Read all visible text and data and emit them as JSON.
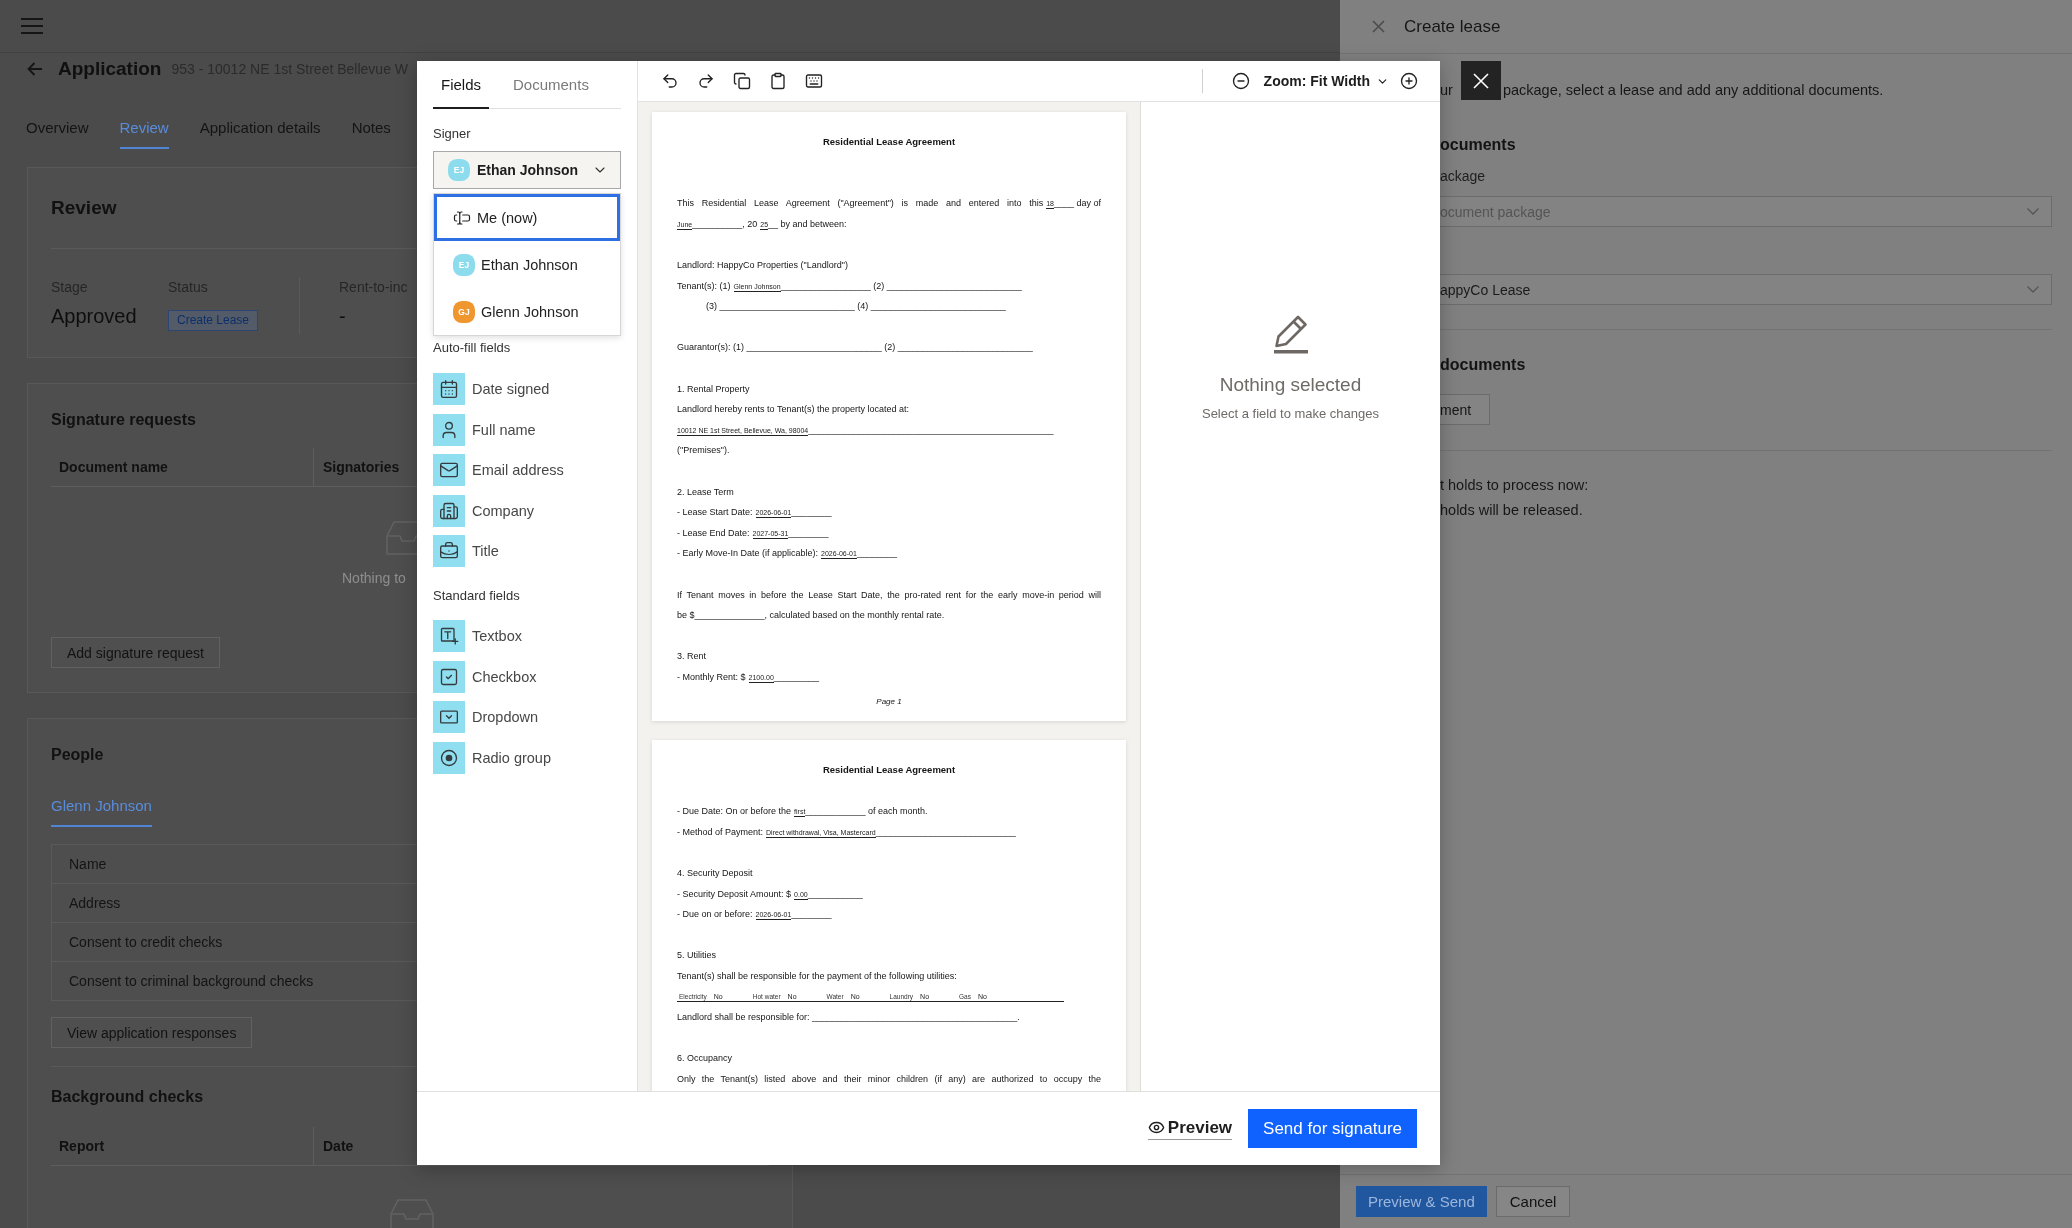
{
  "app": {
    "header": {
      "title": "Application",
      "address": "953 - 10012 NE 1st Street Bellevue W"
    },
    "tabs": [
      {
        "label": "Overview",
        "selected": false
      },
      {
        "label": "Review",
        "selected": true
      },
      {
        "label": "Application details",
        "selected": false
      },
      {
        "label": "Notes",
        "selected": false
      }
    ],
    "review": {
      "title": "Review",
      "stat_groups": [
        [
          {
            "kind": "text",
            "label": "Stage",
            "value": "Approved"
          },
          {
            "kind": "badge",
            "label": "Status",
            "value": "Create Lease"
          }
        ],
        [
          {
            "kind": "text",
            "label": "Rent-to-inc",
            "value": "-"
          }
        ]
      ]
    },
    "signature_requests": {
      "title": "Signature requests",
      "columns": [
        "Document name",
        "Signatories"
      ],
      "empty_text": "Nothing to",
      "button": "Add signature request"
    },
    "people": {
      "title": "People",
      "tabs": [
        {
          "label": "Glenn Johnson",
          "selected": true
        }
      ],
      "rows": [
        "Name",
        "Address",
        "Consent to credit checks",
        "Consent to criminal background checks"
      ],
      "button": "View application responses"
    },
    "background_checks": {
      "title": "Background checks",
      "columns": [
        "Report",
        "Date"
      ]
    }
  },
  "drawer": {
    "title": "Create lease",
    "intro": [
      "ur",
      "package, select a lease and add any additional documents."
    ],
    "package_section": {
      "heading": "ocuments",
      "label": "ackage",
      "selects": [
        {
          "placeholder": "ocument package"
        },
        {
          "value": "appyCo Lease"
        }
      ]
    },
    "documents_section": {
      "heading": "documents",
      "button": "ment"
    },
    "notice": [
      "t holds to process now:",
      "holds will be released."
    ],
    "buttons": [
      {
        "kind": "primary",
        "label": "Preview & Send"
      },
      {
        "kind": "secondary",
        "label": "Cancel"
      }
    ]
  },
  "modal": {
    "tabs": [
      {
        "label": "Fields",
        "selected": true
      },
      {
        "label": "Documents",
        "selected": false
      }
    ],
    "signer": {
      "label": "Signer",
      "current": {
        "initials": "EJ",
        "name": "Ethan Johnson",
        "color": "#8ddcee"
      },
      "expanded": true,
      "options": [
        {
          "kind": "self",
          "label": "Me (now)",
          "selected": true
        },
        {
          "kind": "person",
          "initials": "EJ",
          "label": "Ethan Johnson",
          "color": "#8ddcee",
          "selected": false
        },
        {
          "kind": "person",
          "initials": "GJ",
          "label": "Glenn Johnson",
          "color": "#f0962e",
          "selected": false
        }
      ]
    },
    "field_groups": [
      {
        "title": "Auto-fill fields",
        "items": [
          {
            "kind": "date",
            "label": "Date signed"
          },
          {
            "kind": "person",
            "label": "Full name"
          },
          {
            "kind": "email",
            "label": "Email address"
          },
          {
            "kind": "company",
            "label": "Company"
          },
          {
            "kind": "title",
            "label": "Title"
          }
        ]
      },
      {
        "title": "Standard fields",
        "items": [
          {
            "kind": "textbox",
            "label": "Textbox"
          },
          {
            "kind": "checkbox",
            "label": "Checkbox"
          },
          {
            "kind": "dropdown",
            "label": "Dropdown"
          },
          {
            "kind": "radio",
            "label": "Radio group"
          }
        ]
      }
    ],
    "toolbar": {
      "zoom": "Zoom: Fit Width"
    },
    "pages": [
      {
        "title": "Residential Lease Agreement",
        "continues": false,
        "paragraphs": [
          {
            "lines": [
              {
                "kind": "justified",
                "parts": [
                  {
                    "kind": "text",
                    "text": "This Residential Lease Agreement (\"Agreement\") is made and entered into this"
                  },
                  {
                    "kind": "fill",
                    "text": "18"
                  },
                  {
                    "kind": "text",
                    "text": "____ day of"
                  }
                ]
              },
              {
                "kind": "plain",
                "parts": [
                  {
                    "kind": "fill",
                    "text": "June"
                  },
                  {
                    "kind": "text",
                    "text": "__________, 20"
                  },
                  {
                    "kind": "fill",
                    "text": "25"
                  },
                  {
                    "kind": "text",
                    "text": "__ by and between:"
                  }
                ]
              }
            ]
          },
          {
            "lines": [
              {
                "kind": "plain",
                "parts": [
                  {
                    "kind": "text",
                    "text": "Landlord: HappyCo Properties (\"Landlord\")"
                  }
                ]
              },
              {
                "kind": "plain",
                "parts": [
                  {
                    "kind": "text",
                    "text": "Tenant(s): (1)"
                  },
                  {
                    "kind": "fill",
                    "text": "Glenn Johnson"
                  },
                  {
                    "kind": "text",
                    "text": "__________________ (2) ___________________________"
                  }
                ]
              },
              {
                "kind": "indented",
                "parts": [
                  {
                    "kind": "text",
                    "text": "(3) ___________________________ (4) ___________________________"
                  }
                ]
              }
            ]
          },
          {
            "lines": [
              {
                "kind": "plain",
                "parts": [
                  {
                    "kind": "text",
                    "text": "Guarantor(s): (1) ___________________________ (2) ___________________________"
                  }
                ]
              }
            ]
          },
          {
            "lines": [
              {
                "kind": "plain",
                "parts": [
                  {
                    "kind": "text",
                    "text": "1. Rental Property"
                  }
                ]
              },
              {
                "kind": "plain",
                "parts": [
                  {
                    "kind": "text",
                    "text": "Landlord hereby rents to Tenant(s) the property located at:"
                  }
                ]
              },
              {
                "kind": "plain",
                "parts": [
                  {
                    "kind": "fill",
                    "text": "10012 NE 1st Street, Bellevue, Wa, 98004"
                  },
                  {
                    "kind": "text",
                    "text": "_________________________________________________"
                  }
                ]
              },
              {
                "kind": "plain",
                "parts": [
                  {
                    "kind": "text",
                    "text": "(\"Premises\")."
                  }
                ]
              }
            ]
          },
          {
            "lines": [
              {
                "kind": "plain",
                "parts": [
                  {
                    "kind": "text",
                    "text": "2. Lease Term"
                  }
                ]
              },
              {
                "kind": "plain",
                "parts": [
                  {
                    "kind": "text",
                    "text": "- Lease Start Date:"
                  },
                  {
                    "kind": "fill",
                    "text": "2026-06-01"
                  },
                  {
                    "kind": "text",
                    "text": "________"
                  }
                ]
              },
              {
                "kind": "plain",
                "parts": [
                  {
                    "kind": "text",
                    "text": "- Lease End Date:"
                  },
                  {
                    "kind": "fill",
                    "text": "2027-05-31"
                  },
                  {
                    "kind": "text",
                    "text": "________"
                  }
                ]
              },
              {
                "kind": "plain",
                "parts": [
                  {
                    "kind": "text",
                    "text": "- Early Move-In Date (if applicable):"
                  },
                  {
                    "kind": "fill",
                    "text": "2026-06-01"
                  },
                  {
                    "kind": "text",
                    "text": "________"
                  }
                ]
              }
            ]
          },
          {
            "lines": [
              {
                "kind": "justified",
                "parts": [
                  {
                    "kind": "text",
                    "text": "If Tenant moves in before the Lease Start Date, the pro-rated rent for the early move-in period will"
                  }
                ]
              },
              {
                "kind": "plain",
                "parts": [
                  {
                    "kind": "text",
                    "text": "be $______________, calculated based on the monthly rental rate."
                  }
                ]
              }
            ]
          },
          {
            "lines": [
              {
                "kind": "plain",
                "parts": [
                  {
                    "kind": "text",
                    "text": "3. Rent"
                  }
                ]
              },
              {
                "kind": "plain",
                "parts": [
                  {
                    "kind": "text",
                    "text": "- Monthly Rent: $"
                  },
                  {
                    "kind": "fill",
                    "text": "2100.00"
                  },
                  {
                    "kind": "text",
                    "text": "_________"
                  }
                ]
              }
            ]
          }
        ],
        "footer": "Page 1"
      },
      {
        "title": "Residential Lease Agreement",
        "continues": true,
        "paragraphs": [
          {
            "lines": [
              {
                "kind": "plain",
                "parts": [
                  {
                    "kind": "text",
                    "text": "- Due Date: On or before the"
                  },
                  {
                    "kind": "fill",
                    "text": "first"
                  },
                  {
                    "kind": "text",
                    "text": "____________ of each month."
                  }
                ]
              },
              {
                "kind": "plain",
                "parts": [
                  {
                    "kind": "text",
                    "text": "- Method of Payment:"
                  },
                  {
                    "kind": "fill",
                    "text": "Direct withdrawal, Visa, Mastercard"
                  },
                  {
                    "kind": "text",
                    "text": "____________________________"
                  }
                ]
              }
            ]
          },
          {
            "lines": [
              {
                "kind": "plain",
                "parts": [
                  {
                    "kind": "text",
                    "text": "4. Security Deposit"
                  }
                ]
              },
              {
                "kind": "plain",
                "parts": [
                  {
                    "kind": "text",
                    "text": "- Security Deposit Amount: $"
                  },
                  {
                    "kind": "fill",
                    "text": "0.00"
                  },
                  {
                    "kind": "text",
                    "text": "___________"
                  }
                ]
              },
              {
                "kind": "plain",
                "parts": [
                  {
                    "kind": "text",
                    "text": "- Due on or before:"
                  },
                  {
                    "kind": "fill",
                    "text": "2026-06-01"
                  },
                  {
                    "kind": "text",
                    "text": "________"
                  }
                ]
              }
            ]
          },
          {
            "lines": [
              {
                "kind": "plain",
                "parts": [
                  {
                    "kind": "text",
                    "text": "5. Utilities"
                  }
                ]
              },
              {
                "kind": "plain",
                "parts": [
                  {
                    "kind": "text",
                    "text": "Tenant(s) shall be responsible for the payment of the following utilities:"
                  }
                ]
              },
              {
                "kind": "ruled",
                "parts": [
                  {
                    "kind": "label",
                    "text": "Electricity"
                  },
                  {
                    "kind": "fill",
                    "text": "No"
                  },
                  {
                    "kind": "label",
                    "text": "Hot water"
                  },
                  {
                    "kind": "fill",
                    "text": "No"
                  },
                  {
                    "kind": "label",
                    "text": "Water"
                  },
                  {
                    "kind": "fill",
                    "text": "No"
                  },
                  {
                    "kind": "label",
                    "text": "Laundry"
                  },
                  {
                    "kind": "fill",
                    "text": "No"
                  },
                  {
                    "kind": "label",
                    "text": "Gas"
                  },
                  {
                    "kind": "fill",
                    "text": "No"
                  }
                ]
              },
              {
                "kind": "plain",
                "parts": [
                  {
                    "kind": "text",
                    "text": "Landlord shall be responsible for: _________________________________________."
                  }
                ]
              }
            ]
          },
          {
            "lines": [
              {
                "kind": "plain",
                "parts": [
                  {
                    "kind": "text",
                    "text": "6. Occupancy"
                  }
                ]
              },
              {
                "kind": "justified",
                "parts": [
                  {
                    "kind": "text",
                    "text": "Only the Tenant(s) listed above and their minor children (if any) are authorized to occupy the"
                  }
                ]
              }
            ]
          }
        ]
      }
    ],
    "properties": {
      "title": "Nothing selected",
      "hint": "Select a field to make changes"
    },
    "footer": {
      "preview": "Preview",
      "send": "Send for signature"
    }
  }
}
